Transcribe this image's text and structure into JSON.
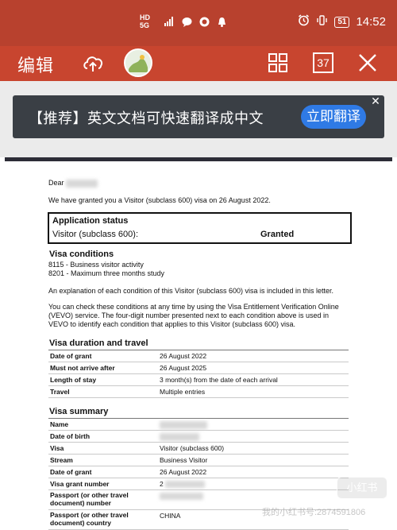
{
  "status_bar": {
    "time": "14:52",
    "battery": "51",
    "signal_label": "HD 5G"
  },
  "toolbar": {
    "edit_label": "编辑",
    "page_count": "37"
  },
  "translate_banner": {
    "text": "【推荐】英文文档可快速翻译成中文",
    "button_label": "立即翻译"
  },
  "document": {
    "greeting": "Dear",
    "grant_line": "We have granted you a Visitor (subclass 600) visa on 26 August 2022.",
    "application_status": {
      "title": "Application status",
      "key": "Visitor (subclass 600):",
      "value": "Granted"
    },
    "visa_conditions": {
      "title": "Visa conditions",
      "items": [
        "8115 - Business visitor activity",
        "8201 - Maximum three months study"
      ],
      "explanation": "An explanation of each condition of this Visitor (subclass 600) visa is included in this letter.",
      "vevo_1": "You can check these conditions at any time by using the Visa Entitlement Verification Online",
      "vevo_2": "(VEVO) service. The four-digit number presented next to each condition above is used in",
      "vevo_3": "VEVO to identify each condition that applies to this Visitor (subclass 600) visa."
    },
    "duration": {
      "title": "Visa duration and travel",
      "rows": [
        {
          "key": "Date of grant",
          "value": "26 August 2022"
        },
        {
          "key": "Must not arrive after",
          "value": "26 August 2025"
        },
        {
          "key": "Length of stay",
          "value": "3 month(s) from the date of each arrival"
        },
        {
          "key": "Travel",
          "value": "Multiple entries"
        }
      ]
    },
    "summary": {
      "title": "Visa summary",
      "rows": [
        {
          "key": "Name",
          "value": ""
        },
        {
          "key": "Date of birth",
          "value": ""
        },
        {
          "key": "Visa",
          "value": "Visitor (subclass 600)"
        },
        {
          "key": "Stream",
          "value": "Business Visitor"
        },
        {
          "key": "Date of grant",
          "value": "26 August 2022"
        },
        {
          "key": "Visa grant number",
          "value": "2"
        },
        {
          "key_line1": "Passport (or other travel",
          "key_line2": "document) number",
          "value": ""
        },
        {
          "key_line1": "Passport (or other travel",
          "key_line2": "document) country",
          "value": "CHINA"
        }
      ]
    }
  },
  "watermark": {
    "logo": "小红书",
    "id": "我的小红书号:2874591806"
  }
}
